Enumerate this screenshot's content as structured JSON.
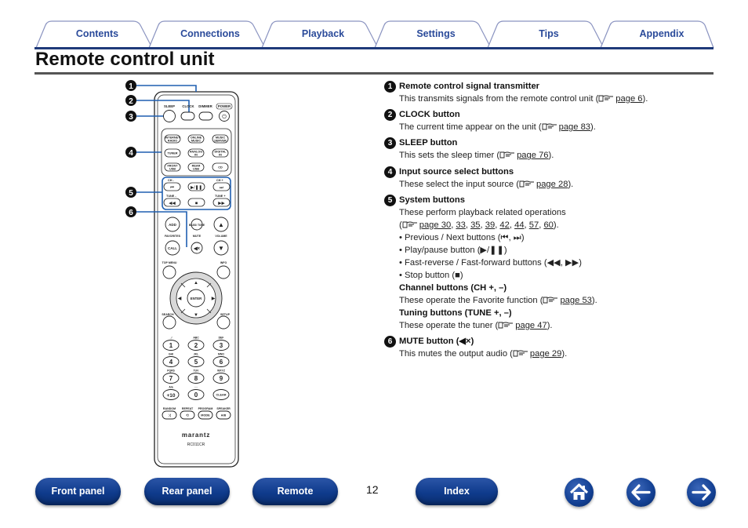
{
  "tabs": [
    {
      "label": "Contents"
    },
    {
      "label": "Connections"
    },
    {
      "label": "Playback"
    },
    {
      "label": "Settings"
    },
    {
      "label": "Tips"
    },
    {
      "label": "Appendix"
    }
  ],
  "page_title": "Remote control unit",
  "remote": {
    "callouts": [
      "1",
      "2",
      "3",
      "4",
      "5",
      "6"
    ],
    "top_labels": {
      "sleep": "SLEEP",
      "clock": "CLOCK",
      "dimmer": "DIMMER",
      "power": "POWER"
    },
    "source_buttons": [
      [
        "INTERNET RADIO",
        "ONLINE MUSIC",
        "MUSIC SERVER"
      ],
      [
        "TUNER",
        "ANALOG IN",
        "DIGITAL IN"
      ],
      [
        "FRONT USB",
        "REAR USB",
        "CD"
      ]
    ],
    "system_labels": {
      "ch_minus": "CH -",
      "ch_plus": "CH +",
      "tune_minus": "TUNE -",
      "tune_plus": "TUNE +"
    },
    "mid_labels": {
      "add": "ADD",
      "bass_tone": "BASS/ TONE",
      "favorites": "FAVORITES",
      "call": "CALL",
      "mute": "MUTE",
      "volume": "VOLUME",
      "top_menu": "TOP MENU",
      "info": "INFO",
      "enter": "ENTER",
      "search": "SEARCH",
      "setup": "SETUP"
    },
    "keypad": [
      {
        "sub": ". /",
        "key": "1"
      },
      {
        "sub": "ABC",
        "key": "2"
      },
      {
        "sub": "DEF",
        "key": "3"
      },
      {
        "sub": "GHI",
        "key": "4"
      },
      {
        "sub": "JKL",
        "key": "5"
      },
      {
        "sub": "MNO",
        "key": "6"
      },
      {
        "sub": "PQRS",
        "key": "7"
      },
      {
        "sub": "TUV",
        "key": "8"
      },
      {
        "sub": "WXYZ",
        "key": "9"
      },
      {
        "sub": "A/a",
        "key": "+10"
      },
      {
        "sub": "- -",
        "key": "0"
      },
      {
        "sub": "",
        "key": "CLEAR"
      }
    ],
    "bottom_labels": {
      "random": "RANDOM",
      "repeat": "REPEAT",
      "program": "PROGRAM",
      "speaker": "SPEAKER",
      "mode": "MODE",
      "ab": "A/B"
    },
    "brand": "marantz",
    "model": "RC011CR"
  },
  "items": [
    {
      "num": "1",
      "heading": "Remote control signal transmitter",
      "text": "This transmits signals from the remote control unit (",
      "link": "page 6",
      "after": ")."
    },
    {
      "num": "2",
      "heading": "CLOCK button",
      "text": "The current time appear on the unit (",
      "link": "page 83",
      "after": ")."
    },
    {
      "num": "3",
      "heading": "SLEEP button",
      "text": "This sets the sleep timer (",
      "link": "page 76",
      "after": ")."
    },
    {
      "num": "4",
      "heading": "Input source select buttons",
      "text": "These select the input source (",
      "link": "page 28",
      "after": ")."
    },
    {
      "num": "5",
      "heading": "System buttons",
      "text": "These perform playback related operations",
      "links": [
        "page 30",
        "33",
        "35",
        "39",
        "42",
        "44",
        "57",
        "60"
      ],
      "bullets": [
        "• Previous / Next buttons (⏮, ⏭)",
        "• Play/pause button (▶/❚❚)",
        "• Fast-reverse / Fast-forward buttons (◀◀, ▶▶)",
        "• Stop button (■)"
      ],
      "sub": [
        {
          "heading": "Channel buttons (CH +, –)",
          "text": "These operate the Favorite function (",
          "link": "page 53",
          "after": ")."
        },
        {
          "heading": "Tuning buttons (TUNE +, –)",
          "text": "These operate the tuner (",
          "link": "page 47",
          "after": ")."
        }
      ]
    },
    {
      "num": "6",
      "heading": "MUTE button (🔇)",
      "text": "This mutes the output audio (",
      "link": "page 29",
      "after": ")."
    }
  ],
  "bottom_nav": {
    "front_panel": "Front panel",
    "rear_panel": "Rear panel",
    "remote": "Remote",
    "page_number": "12",
    "index": "Index"
  }
}
